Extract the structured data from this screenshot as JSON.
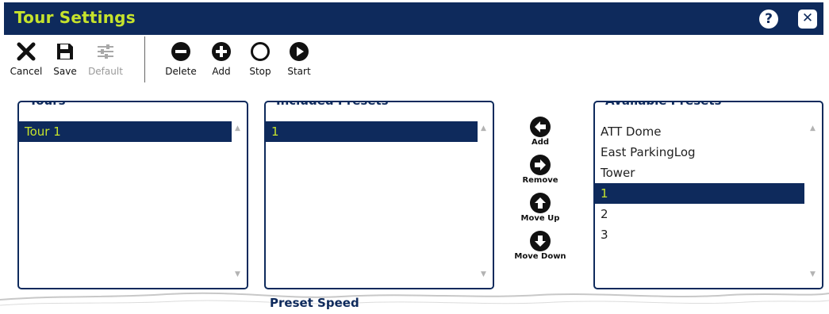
{
  "window": {
    "title": "Tour Settings"
  },
  "toolbar": {
    "cancel_label": "Cancel",
    "save_label": "Save",
    "default_label": "Default",
    "delete_label": "Delete",
    "add_label": "Add",
    "stop_label": "Stop",
    "start_label": "Start"
  },
  "tours": {
    "title": "Tours",
    "items": [
      {
        "label": "Tour 1",
        "selected": true
      }
    ]
  },
  "included": {
    "title": "Included Presets",
    "items": [
      {
        "label": "1",
        "selected": true
      }
    ]
  },
  "available": {
    "title": "Available Presets",
    "items": [
      {
        "label": "ATT Dome",
        "selected": false
      },
      {
        "label": "East ParkingLog",
        "selected": false
      },
      {
        "label": "Tower",
        "selected": false
      },
      {
        "label": "1",
        "selected": true
      },
      {
        "label": "2",
        "selected": false
      },
      {
        "label": "3",
        "selected": false
      }
    ]
  },
  "move_buttons": {
    "add_label": "Add",
    "remove_label": "Remove",
    "move_up_label": "Move Up",
    "move_down_label": "Move Down"
  },
  "preset_speed": {
    "title": "Preset Speed"
  },
  "icons": {
    "help": "question-icon",
    "close": "close-icon",
    "cancel": "x-icon",
    "save": "floppy-icon",
    "default": "sliders-icon",
    "delete": "minus-circle-icon",
    "add": "plus-circle-icon",
    "stop": "circle-outline-icon",
    "start": "play-circle-icon"
  },
  "colors": {
    "title_bg": "#0e2a5c",
    "title_text": "#c6e32c",
    "selected_bg": "#0e2a5c",
    "selected_text": "#c6e32c"
  }
}
